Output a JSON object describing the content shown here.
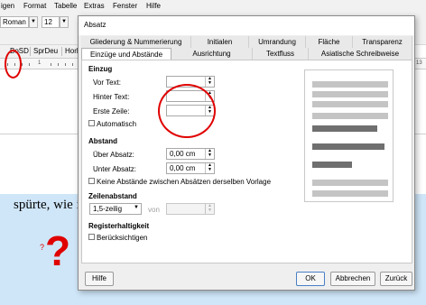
{
  "menubar": {
    "items": [
      "igen",
      "Format",
      "Tabelle",
      "Extras",
      "Fenster",
      "Hilfe"
    ]
  },
  "toolbar": {
    "font_name": "Roman",
    "font_size": "12"
  },
  "stylebar": {
    "items": [
      "BoSD",
      "SprDeu",
      "Horl"
    ]
  },
  "ruler": {
    "left_num": "1",
    "right_num": "13"
  },
  "document": {
    "text": "spürte, wie i",
    "small_qmark": "?",
    "big_qmark": "?"
  },
  "dialog": {
    "title": "Absatz",
    "tabs_top": [
      "Gliederung & Nummerierung",
      "Initialen",
      "Umrandung",
      "Fläche",
      "Transparenz"
    ],
    "tabs_bottom": [
      "Einzüge und Abstände",
      "Ausrichtung",
      "Textfluss",
      "Asiatische Schreibweise"
    ],
    "einzug": {
      "title": "Einzug",
      "vor_text": "Vor Text:",
      "hinter_text": "Hinter Text:",
      "erste_zeile": "Erste Zeile:",
      "automatisch": "Automatisch"
    },
    "abstand": {
      "title": "Abstand",
      "ueber_absatz": "Über Absatz:",
      "ueber_value": "0,00 cm",
      "unter_absatz": "Unter Absatz:",
      "unter_value": "0,00 cm",
      "keine_abstaende": "Keine Abstände zwischen Absätzen derselben Vorlage"
    },
    "zeilenabstand": {
      "title": "Zeilenabstand",
      "value": "1,5-zeilig",
      "von": "von"
    },
    "registerhaltigkeit": {
      "title": "Registerhaltigkeit",
      "beruecksichtigen": "Berücksichtigen"
    },
    "buttons": {
      "hilfe": "Hilfe",
      "ok": "OK",
      "abbrechen": "Abbrechen",
      "zurueck": "Zurück"
    }
  },
  "colors": {
    "accent_red": "#e00000",
    "page_blue": "#cfe6f8",
    "preview_gray": "#c4c4c4",
    "preview_dark": "#6f6f6f"
  }
}
